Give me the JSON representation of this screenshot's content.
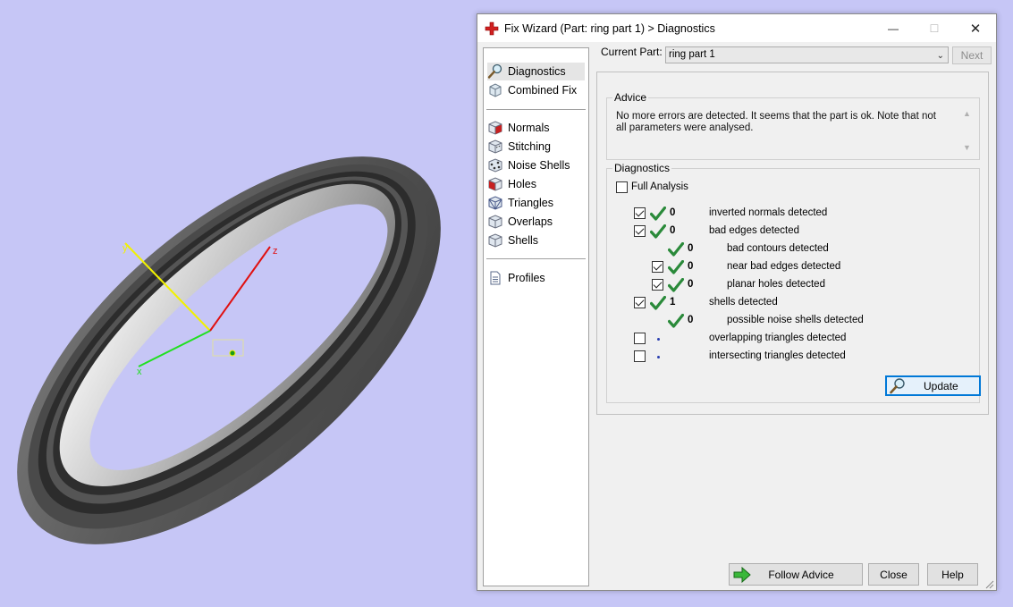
{
  "viewport": {
    "background": "#c6c6f6",
    "axis_labels": {
      "x": "x",
      "y": "y",
      "z": "z"
    }
  },
  "dialog": {
    "title": "Fix Wizard (Part: ring part 1) > Diagnostics",
    "window_controls": {
      "minimize": "—",
      "maximize": "☐",
      "close": "✕"
    }
  },
  "sidebar": {
    "groups": [
      [
        {
          "label": "Diagnostics",
          "icon": "magnifier-icon",
          "active": true
        },
        {
          "label": "Combined Fix",
          "icon": "combined-fix-icon"
        }
      ],
      [
        {
          "label": "Normals",
          "icon": "normals-cube-icon"
        },
        {
          "label": "Stitching",
          "icon": "stitching-cube-icon"
        },
        {
          "label": "Noise Shells",
          "icon": "noise-shells-icon"
        },
        {
          "label": "Holes",
          "icon": "holes-cube-icon"
        },
        {
          "label": "Triangles",
          "icon": "triangles-cube-icon"
        },
        {
          "label": "Overlaps",
          "icon": "overlaps-cube-icon"
        },
        {
          "label": "Shells",
          "icon": "shells-cube-icon"
        }
      ],
      [
        {
          "label": "Profiles",
          "icon": "profiles-icon"
        }
      ]
    ]
  },
  "part_selector": {
    "label": "Current Part:",
    "value": "ring part 1",
    "next_label": "Next"
  },
  "advice": {
    "title": "Advice",
    "text": "No more errors are detected. It seems that the part is ok. Note that not all parameters were analysed."
  },
  "diagnostics": {
    "title": "Diagnostics",
    "full_analysis": {
      "label": "Full Analysis",
      "checked": false
    },
    "rows": [
      {
        "indent": 0,
        "checkbox": true,
        "checked": true,
        "status": "ok",
        "count": "0",
        "label": "inverted normals detected"
      },
      {
        "indent": 0,
        "checkbox": true,
        "checked": true,
        "status": "ok",
        "count": "0",
        "label": "bad edges detected"
      },
      {
        "indent": 1,
        "checkbox": false,
        "checked": false,
        "status": "ok",
        "count": "0",
        "label": "bad contours detected"
      },
      {
        "indent": 1,
        "checkbox": true,
        "checked": true,
        "status": "ok",
        "count": "0",
        "label": "near bad edges detected"
      },
      {
        "indent": 1,
        "checkbox": true,
        "checked": true,
        "status": "ok",
        "count": "0",
        "label": "planar holes detected"
      },
      {
        "indent": 0,
        "checkbox": true,
        "checked": true,
        "status": "ok",
        "count": "1",
        "label": "shells detected"
      },
      {
        "indent": 1,
        "checkbox": false,
        "checked": false,
        "status": "ok",
        "count": "0",
        "label": "possible noise shells detected"
      },
      {
        "indent": 0,
        "checkbox": true,
        "checked": false,
        "status": "pending",
        "count": "",
        "label": "overlapping triangles detected"
      },
      {
        "indent": 0,
        "checkbox": true,
        "checked": false,
        "status": "pending",
        "count": "",
        "label": "intersecting triangles detected"
      }
    ],
    "update_label": "Update"
  },
  "footer": {
    "follow_label": "Follow Advice",
    "close_label": "Close",
    "help_label": "Help"
  },
  "colors": {
    "check_green": "#2a8a3a",
    "title_icon_red": "#d02020",
    "pending_dot": "#2a3fb0",
    "focus_blue": "#0078d7"
  }
}
